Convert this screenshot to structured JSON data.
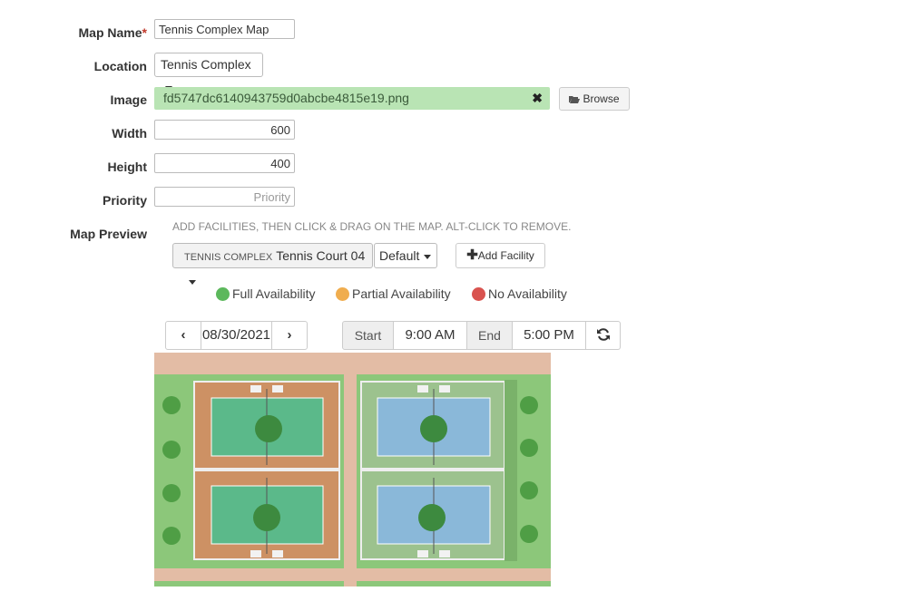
{
  "form": {
    "map_name": {
      "label": "Map Name",
      "required_mark": "*",
      "value": "Tennis Complex Map"
    },
    "location": {
      "label": "Location",
      "value": "Tennis Complex"
    },
    "image": {
      "label": "Image",
      "filename": "fd5747dc6140943759d0abcbe4815e19.png",
      "remove_glyph": "✖",
      "browse_label": "Browse"
    },
    "width": {
      "label": "Width",
      "value": "600"
    },
    "height": {
      "label": "Height",
      "value": "400"
    },
    "priority": {
      "label": "Priority",
      "placeholder": "Priority"
    }
  },
  "preview": {
    "label": "Map Preview",
    "hint": "Add facilities, then click & drag on the map. Alt-click to remove.",
    "facility_group": "TENNIS COMPLEX",
    "facility": "Tennis Court 04",
    "style": "Default",
    "add_facility_label": "Add Facility"
  },
  "legend": [
    {
      "label": "Full Availability",
      "color": "#5cb85c"
    },
    {
      "label": "Partial Availability",
      "color": "#f0ad4e"
    },
    {
      "label": "No Availability",
      "color": "#d9534f"
    }
  ],
  "date_nav": {
    "date": "08/30/2021",
    "prev_icon": "chevron-left-icon",
    "next_icon": "chevron-right-icon"
  },
  "time_range": {
    "start_label": "Start",
    "start": "9:00 AM",
    "end_label": "End",
    "end": "5:00 PM",
    "refresh_icon": "refresh-icon"
  }
}
